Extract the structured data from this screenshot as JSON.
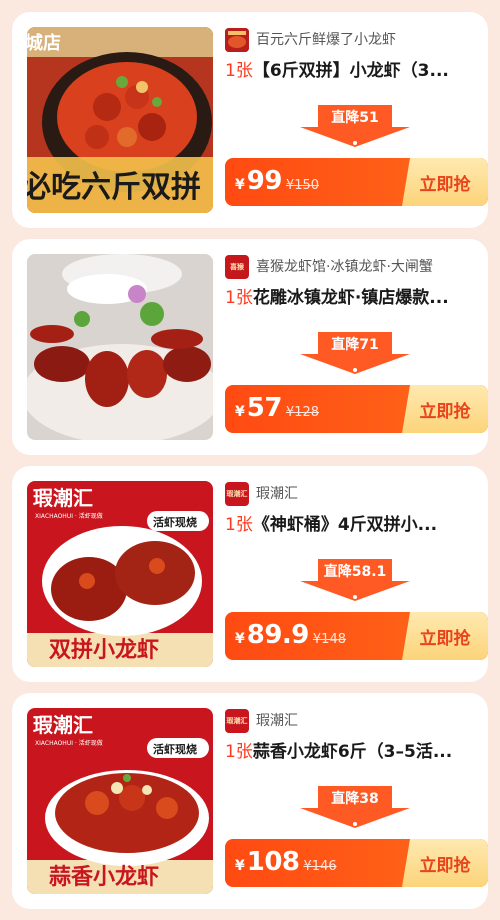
{
  "deals": [
    {
      "shop_name": "百元六斤鲜爆了小龙虾",
      "logo_text": "",
      "qty": "1张",
      "title": "【6斤双拼】小龙虾（3...",
      "discount": "直降51",
      "currency": "¥",
      "price": "99",
      "original_price": "¥150",
      "buy_label": "立即抢",
      "image_text": [
        "城店",
        "必吃六斤双拼"
      ]
    },
    {
      "shop_name": "喜猴龙虾馆·冰镇龙虾·大闸蟹",
      "logo_text": "喜猴",
      "qty": "1张",
      "title": "花雕冰镇龙虾·镇店爆款...",
      "discount": "直降71",
      "currency": "¥",
      "price": "57",
      "original_price": "¥128",
      "buy_label": "立即抢",
      "image_text": []
    },
    {
      "shop_name": "瑕潮汇",
      "logo_text": "瑕潮汇",
      "qty": "1张",
      "title": "《神虾桶》4斤双拼小...",
      "discount": "直降58.1",
      "currency": "¥",
      "price": "89.9",
      "original_price": "¥148",
      "buy_label": "立即抢",
      "image_text": [
        "瑕潮汇",
        "XIACHAOHUI · 活虾现做",
        "活虾现烧",
        "双拼小龙虾"
      ]
    },
    {
      "shop_name": "瑕潮汇",
      "logo_text": "瑕潮汇",
      "qty": "1张",
      "title": "蒜香小龙虾6斤（3–5活...",
      "discount": "直降38",
      "currency": "¥",
      "price": "108",
      "original_price": "¥146",
      "buy_label": "立即抢",
      "image_text": [
        "瑕潮汇",
        "XIACHAOHUI · 活虾现做",
        "活虾现烧",
        "蒜香小龙虾"
      ]
    }
  ],
  "colors": {
    "page_bg": "#fbe9df",
    "accent": "#ff4a12",
    "buy_bg": "#fcd47a",
    "qty_red": "#ff3b1f"
  }
}
